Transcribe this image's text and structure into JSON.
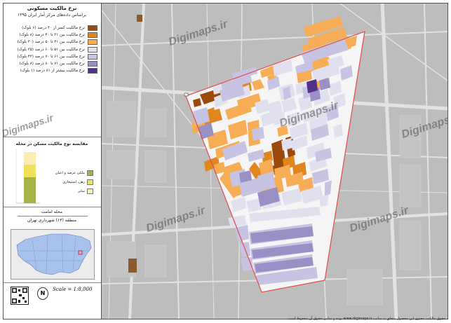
{
  "title": "نرخ مالکیت مسکونی",
  "subtitle": "براساس داده‌های مرکز آمار ایران ۱۳۹۵",
  "legend": {
    "items": [
      {
        "label": "نرخ مالکیت کمتر از ۳۰ درصد (۶ بلوک)",
        "color": "#9c4a0c"
      },
      {
        "label": "نرخ مالکیت بین ۳۱ تا ۴۰ درصد (۸ بلوک)",
        "color": "#e0861f"
      },
      {
        "label": "نرخ مالکیت بین ۴۱ تا ۵۰ درصد (۳۰ بلوک)",
        "color": "#f6ad55"
      },
      {
        "label": "نرخ مالکیت بین ۵۱ تا ۶۰ درصد (۳۵ بلوک)",
        "color": "#e1e0ef"
      },
      {
        "label": "نرخ مالکیت بین ۶۱ تا ۷۰ درصد (۴۳ بلوک)",
        "color": "#c7c4e3"
      },
      {
        "label": "نرخ مالکیت بین ۷۱ تا ۸۰ درصد (۸ بلوک)",
        "color": "#9a90c6"
      },
      {
        "label": "نرخ مالکیت بیشتر از ۸۱ درصد (۱ بلوک)",
        "color": "#55308a"
      }
    ]
  },
  "bar_chart": {
    "title": "مقایسه نوع مالکیت مسکن در محله",
    "keys": [
      {
        "label": "ملکی عرصه و اعیان",
        "color": "#a6b24a"
      },
      {
        "label": "رهن، استیجاری",
        "color": "#f0e15a"
      },
      {
        "label": "سایر",
        "color": "#fbeeb0"
      }
    ]
  },
  "inset": {
    "neighborhood": "محله امامت",
    "district": "منطقه (۱۳) شهرداری تهران"
  },
  "scale": "Scale = 1:8,000",
  "north": "N",
  "watermark": "Digimaps.ir",
  "copyright": "حقوق مالکیت معنوی این محصول متعلق به سایت www.digimaps.ir بوده و تمامی حقوق آن محفوظ است.",
  "colors": {
    "boundary": "#e34a4a",
    "road": "#e9e9e9",
    "background": "#bdbdbd"
  }
}
